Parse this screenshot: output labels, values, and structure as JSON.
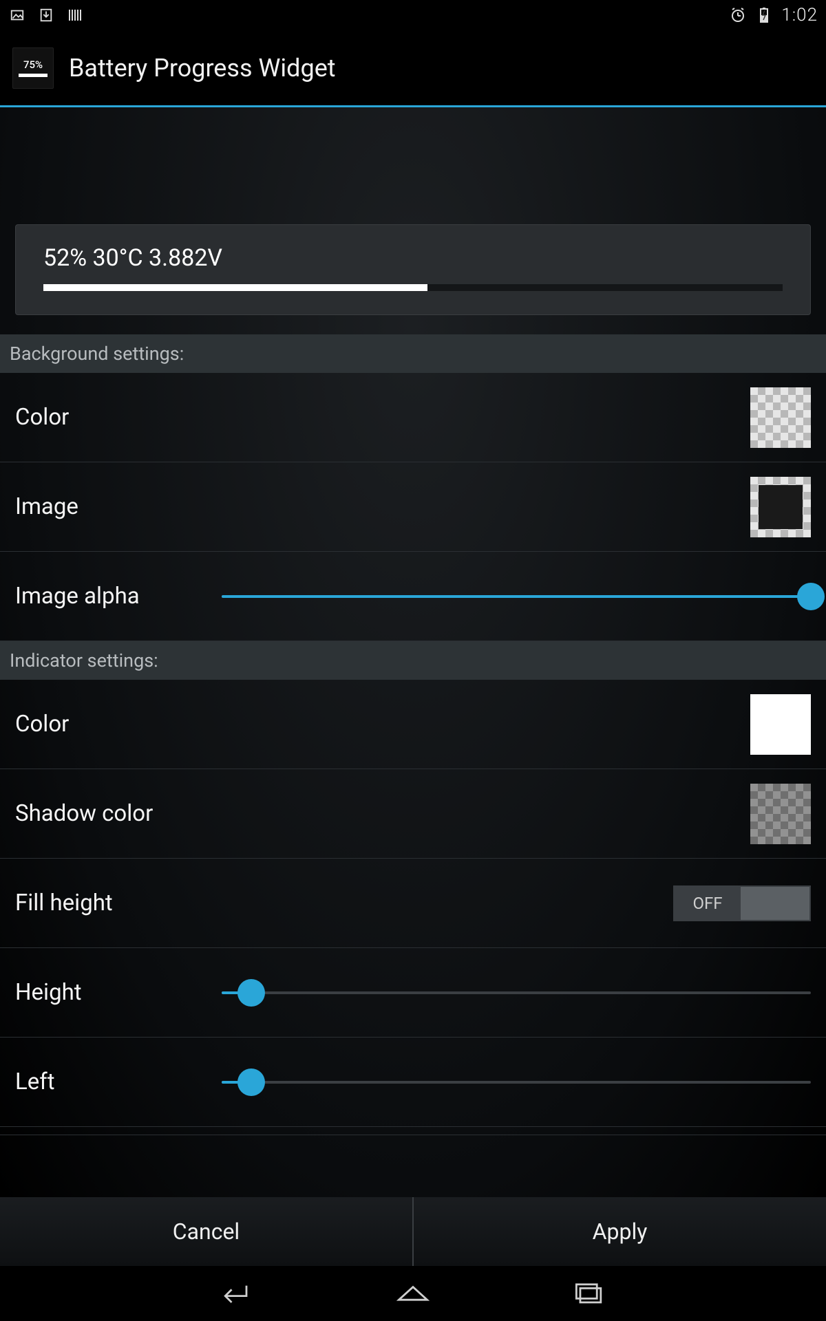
{
  "status": {
    "clock": "1:02"
  },
  "app": {
    "icon_pct": "75%",
    "title": "Battery Progress Widget"
  },
  "preview": {
    "text": "52% 30°C 3.882V",
    "fill_percent": 52
  },
  "sections": {
    "background": {
      "header": "Background settings:",
      "color_label": "Color",
      "image_label": "Image",
      "image_alpha_label": "Image alpha",
      "image_alpha_value": 100
    },
    "indicator": {
      "header": "Indicator settings:",
      "color_label": "Color",
      "shadow_label": "Shadow color",
      "fill_height_label": "Fill height",
      "fill_height_state": "OFF",
      "height_label": "Height",
      "height_value": 5,
      "left_label": "Left",
      "left_value": 5
    }
  },
  "buttons": {
    "cancel": "Cancel",
    "apply": "Apply"
  }
}
